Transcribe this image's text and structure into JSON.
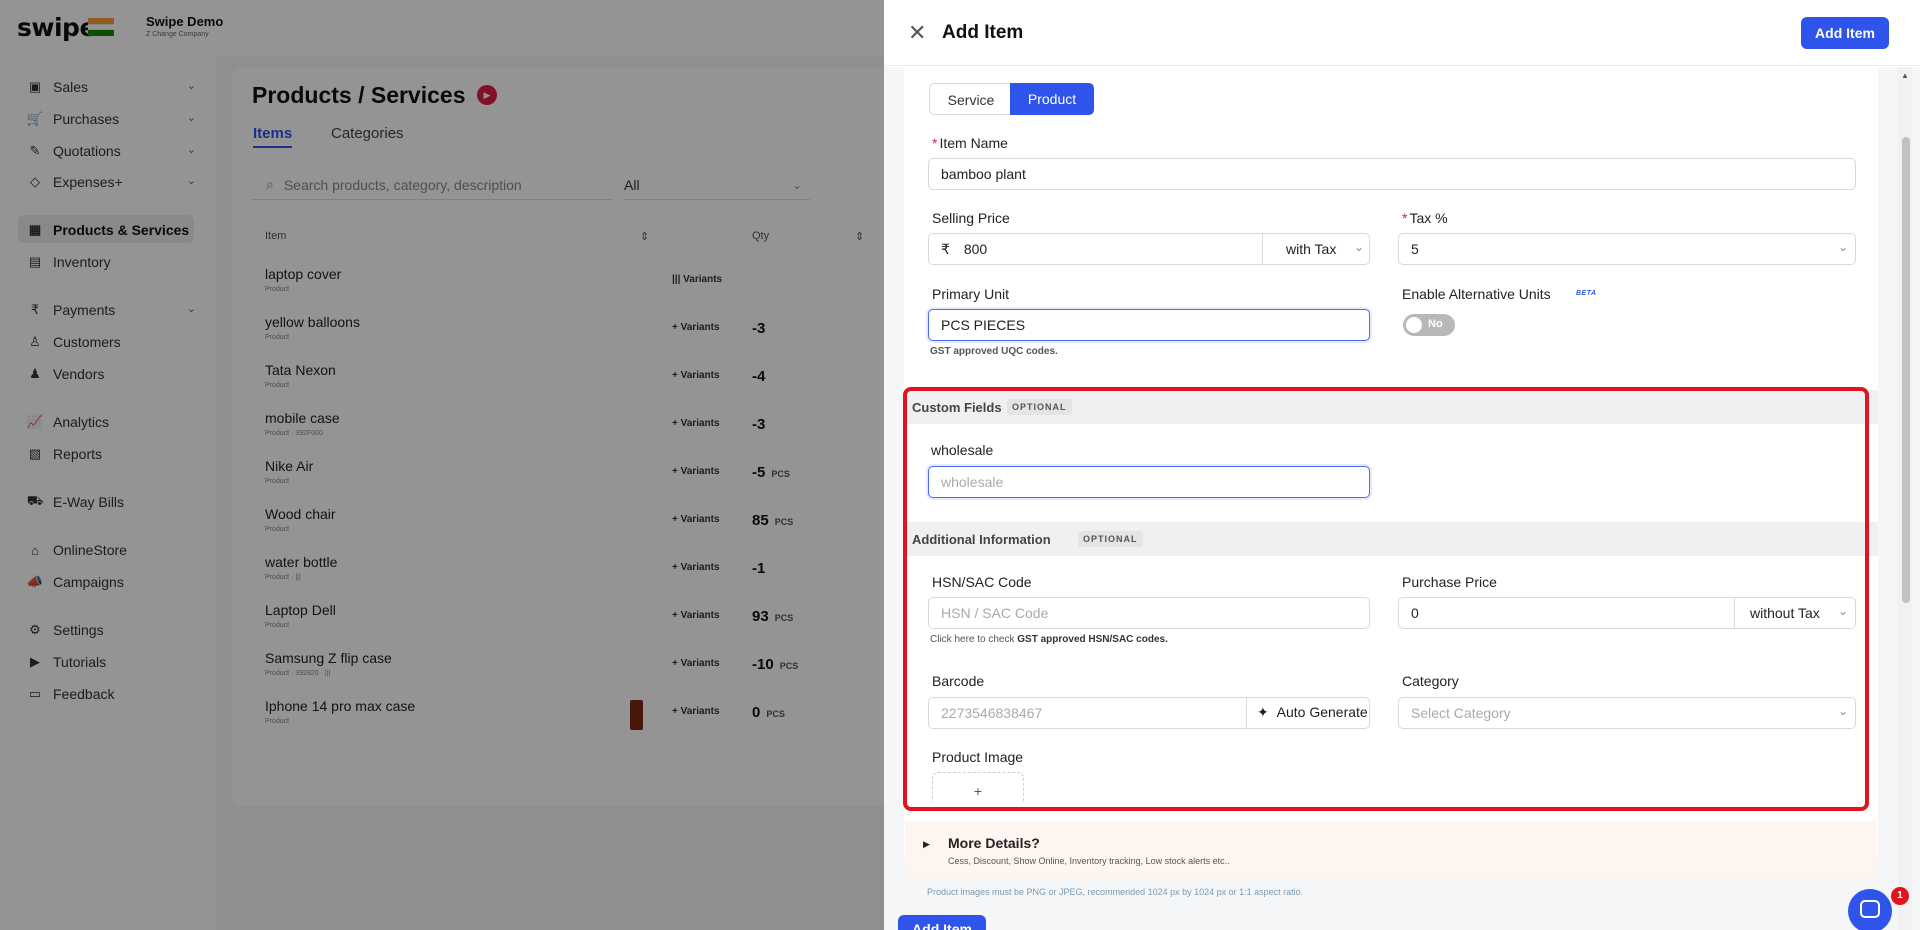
{
  "brand": {
    "logo": "swipe",
    "company_name": "Swipe Demo",
    "company_sub": "Z Change Company"
  },
  "sidebar": {
    "items": [
      {
        "label": "Sales",
        "icon": "cash-icon",
        "glyph": "▣",
        "chevron": "⌄"
      },
      {
        "label": "Purchases",
        "icon": "cart-icon",
        "glyph": "🛒",
        "chevron": "⌄"
      },
      {
        "label": "Quotations",
        "icon": "pen-icon",
        "glyph": "✎",
        "chevron": "⌄"
      },
      {
        "label": "Expenses+",
        "icon": "tag-icon",
        "glyph": "◇",
        "chevron": "⌄"
      },
      {
        "label": "Products & Services",
        "icon": "box-icon",
        "glyph": "▦",
        "chevron": ""
      },
      {
        "label": "Inventory",
        "icon": "inventory-icon",
        "glyph": "▤",
        "chevron": ""
      },
      {
        "label": "Payments",
        "icon": "rupee-icon",
        "glyph": "₹",
        "chevron": "⌄"
      },
      {
        "label": "Customers",
        "icon": "user-icon",
        "glyph": "♙",
        "chevron": ""
      },
      {
        "label": "Vendors",
        "icon": "users-icon",
        "glyph": "♟",
        "chevron": ""
      },
      {
        "label": "Analytics",
        "icon": "chart-icon",
        "glyph": "📈",
        "chevron": ""
      },
      {
        "label": "Reports",
        "icon": "report-icon",
        "glyph": "▧",
        "chevron": ""
      },
      {
        "label": "E-Way Bills",
        "icon": "truck-icon",
        "glyph": "⛟",
        "chevron": ""
      },
      {
        "label": "OnlineStore",
        "icon": "store-icon",
        "glyph": "⌂",
        "chevron": ""
      },
      {
        "label": "Campaigns",
        "icon": "megaphone-icon",
        "glyph": "📣",
        "chevron": ""
      },
      {
        "label": "Settings",
        "icon": "gear-icon",
        "glyph": "⚙",
        "chevron": ""
      },
      {
        "label": "Tutorials",
        "icon": "youtube-icon",
        "glyph": "▶",
        "chevron": ""
      },
      {
        "label": "Feedback",
        "icon": "chat-icon",
        "glyph": "▭",
        "chevron": ""
      }
    ]
  },
  "products_page": {
    "title": "Products / Services",
    "tabs": [
      "Items",
      "Categories"
    ],
    "search_placeholder": "Search products, category, description",
    "filter_value": "All",
    "columns": [
      "Item",
      "Qty"
    ],
    "rows": [
      {
        "name": "laptop cover",
        "kind": "Product",
        "variants": "||| Variants",
        "qty": "",
        "unit": ""
      },
      {
        "name": "yellow balloons",
        "kind": "Product",
        "variants": "+ Variants",
        "qty": "-3",
        "unit": ""
      },
      {
        "name": "Tata Nexon",
        "kind": "Product",
        "variants": "+ Variants",
        "qty": "-4",
        "unit": ""
      },
      {
        "name": "mobile case",
        "kind": "Product · 392F000",
        "variants": "+ Variants",
        "qty": "-3",
        "unit": ""
      },
      {
        "name": "Nike Air",
        "kind": "Product",
        "variants": "+ Variants",
        "qty": "-5",
        "unit": "PCS"
      },
      {
        "name": "Wood chair",
        "kind": "Product",
        "variants": "+ Variants",
        "qty": "85",
        "unit": "PCS"
      },
      {
        "name": "water bottle",
        "kind": "Product · |||",
        "variants": "+ Variants",
        "qty": "-1",
        "unit": ""
      },
      {
        "name": "Laptop Dell",
        "kind": "Product",
        "variants": "+ Variants",
        "qty": "93",
        "unit": "PCS"
      },
      {
        "name": "Samsung Z flip case",
        "kind": "Product · 392820 · |||",
        "variants": "+ Variants",
        "qty": "-10",
        "unit": "PCS"
      },
      {
        "name": "Iphone 14 pro max case",
        "kind": "Product",
        "variants": "+ Variants",
        "qty": "0",
        "unit": "PCS"
      }
    ]
  },
  "drawer": {
    "close_glyph": "✕",
    "title": "Add Item",
    "add_button": "Add Item",
    "type_options": [
      "Service",
      "Product"
    ],
    "selected_type": "Product",
    "item_name": {
      "label": "Item Name",
      "required_mark": "*",
      "value": "bamboo plant"
    },
    "selling_price": {
      "label": "Selling Price",
      "currency": "₹",
      "value": "800",
      "tax_mode": "with Tax"
    },
    "tax": {
      "label": "Tax %",
      "required_mark": "*",
      "value": "5"
    },
    "primary_unit": {
      "label": "Primary Unit",
      "value": "PCS PIECES",
      "hint": "GST approved UQC codes."
    },
    "alt_units": {
      "label": "Enable Alternative Units",
      "badge": "BETA",
      "toggle_text": "No",
      "enabled": false
    },
    "custom_fields": {
      "title": "Custom Fields",
      "badge": "OPTIONAL",
      "field_label": "wholesale",
      "field_placeholder": "wholesale"
    },
    "additional_info": {
      "title": "Additional Information",
      "badge": "OPTIONAL"
    },
    "hsn": {
      "label": "HSN/SAC Code",
      "placeholder": "HSN / SAC Code",
      "hint_prefix": "Click here to check ",
      "hint_bold": "GST approved HSN/SAC codes."
    },
    "purchase_price": {
      "label": "Purchase Price",
      "value": "0",
      "tax_mode": "without Tax"
    },
    "barcode": {
      "label": "Barcode",
      "placeholder": "2273546838467",
      "auto_generate": "Auto Generate",
      "wand_glyph": "✦"
    },
    "category": {
      "label": "Category",
      "placeholder": "Select Category"
    },
    "product_image": {
      "label": "Product Image",
      "plus": "+"
    },
    "more_details": {
      "title": "More Details?",
      "subtitle": "Cess, Discount, Show Online, Inventory tracking, Low stock alerts etc.."
    },
    "image_note": "Product images must be PNG or JPEG, recommended 1024 px by 1024 px or 1:1 aspect ratio.",
    "bottom_add_button": "Add Item"
  },
  "chat": {
    "badge_count": "1"
  },
  "colors": {
    "primary": "#2f54eb",
    "highlight": "#e0141f",
    "required": "#e11d48"
  }
}
